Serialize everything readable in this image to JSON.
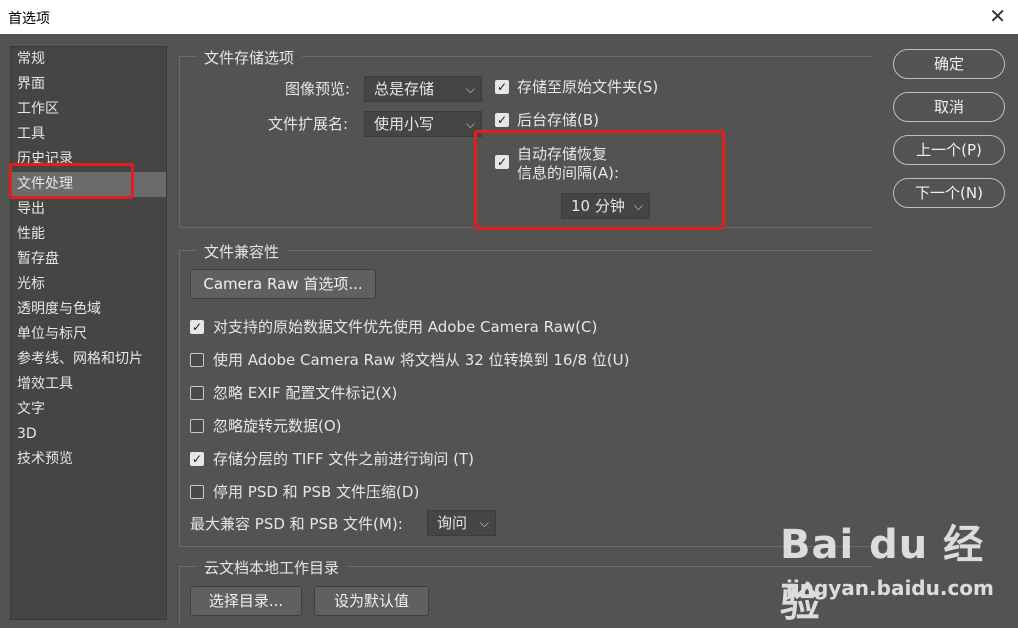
{
  "window": {
    "title": "首选项",
    "close_glyph": "✕"
  },
  "sidebar": {
    "items": [
      {
        "label": "常规"
      },
      {
        "label": "界面"
      },
      {
        "label": "工作区"
      },
      {
        "label": "工具"
      },
      {
        "label": "历史记录"
      },
      {
        "label": "文件处理",
        "selected": true
      },
      {
        "label": "导出"
      },
      {
        "label": "性能"
      },
      {
        "label": "暂存盘"
      },
      {
        "label": "光标"
      },
      {
        "label": "透明度与色域"
      },
      {
        "label": "单位与标尺"
      },
      {
        "label": "参考线、网格和切片"
      },
      {
        "label": "增效工具"
      },
      {
        "label": "文字"
      },
      {
        "label": "3D"
      },
      {
        "label": "技术预览"
      }
    ]
  },
  "file_saving": {
    "title": "文件存储选项",
    "image_preview_label": "图像预览:",
    "image_preview_value": "总是存储",
    "extension_label": "文件扩展名:",
    "extension_value": "使用小写",
    "save_to_original": {
      "label": "存储至原始文件夹(S)",
      "checked": true
    },
    "background_save": {
      "label": "后台存储(B)",
      "checked": true
    },
    "auto_recovery": {
      "line1": "自动存储恢复",
      "line2": "信息的间隔(A):",
      "checked": true
    },
    "interval_value": "10 分钟"
  },
  "compatibility": {
    "title": "文件兼容性",
    "camera_raw_button": "Camera Raw 首选项...",
    "options": [
      {
        "label": "对支持的原始数据文件优先使用 Adobe Camera Raw(C)",
        "checked": true
      },
      {
        "label": "使用 Adobe Camera Raw 将文档从 32 位转换到 16/8 位(U)",
        "checked": false
      },
      {
        "label": "忽略 EXIF 配置文件标记(X)",
        "checked": false
      },
      {
        "label": "忽略旋转元数据(O)",
        "checked": false
      },
      {
        "label": "存储分层的 TIFF 文件之前进行询问 (T)",
        "checked": true
      },
      {
        "label": "停用 PSD 和 PSB 文件压缩(D)",
        "checked": false
      }
    ],
    "max_compat_label": "最大兼容 PSD 和 PSB 文件(M):",
    "max_compat_value": "询问"
  },
  "cloud": {
    "title": "云文档本地工作目录",
    "choose_button": "选择目录...",
    "default_button": "设为默认值"
  },
  "actions": {
    "ok": "确定",
    "cancel": "取消",
    "prev": "上一个(P)",
    "next": "下一个(N)"
  },
  "watermark": {
    "logo": "Bai du 经验",
    "url": "jingyan.baidu.com"
  },
  "colors": {
    "highlight": "#e0201a",
    "panel": "#535353"
  }
}
